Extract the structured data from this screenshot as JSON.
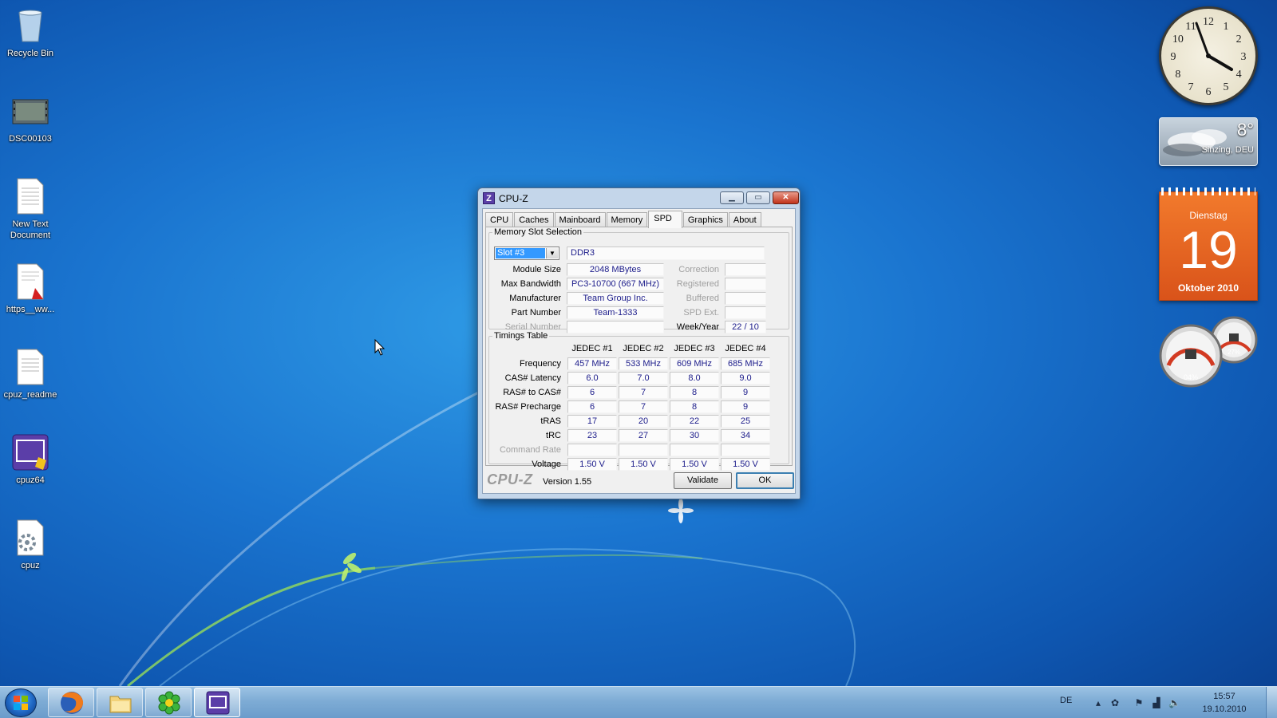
{
  "desktop": {
    "icons": [
      {
        "label": "Recycle Bin"
      },
      {
        "label": "DSC00103"
      },
      {
        "label": "New Text Document"
      },
      {
        "label": "https__ww..."
      },
      {
        "label": "cpuz_readme"
      },
      {
        "label": "cpuz64"
      },
      {
        "label": "cpuz"
      }
    ]
  },
  "window": {
    "title": "CPU-Z",
    "tabs": [
      "CPU",
      "Caches",
      "Mainboard",
      "Memory",
      "SPD",
      "Graphics",
      "About"
    ],
    "active_tab": "SPD",
    "slot_group": {
      "legend": "Memory Slot Selection",
      "slot_selected": "Slot #3",
      "memory_type": "DDR3",
      "labels": {
        "module_size": "Module Size",
        "max_bandwidth": "Max Bandwidth",
        "manufacturer": "Manufacturer",
        "part_number": "Part Number",
        "serial_number": "Serial Number",
        "correction": "Correction",
        "registered": "Registered",
        "buffered": "Buffered",
        "spd_ext": "SPD Ext.",
        "week_year": "Week/Year"
      },
      "values": {
        "module_size": "2048 MBytes",
        "max_bandwidth": "PC3-10700 (667 MHz)",
        "manufacturer": "Team Group Inc.",
        "part_number": "Team-1333",
        "serial_number": "",
        "correction": "",
        "registered": "",
        "buffered": "",
        "spd_ext": "",
        "week_year": "22 / 10"
      }
    },
    "timings": {
      "legend": "Timings Table",
      "columns": [
        "JEDEC #1",
        "JEDEC #2",
        "JEDEC #3",
        "JEDEC #4"
      ],
      "rows": [
        {
          "label": "Frequency",
          "values": [
            "457 MHz",
            "533 MHz",
            "609 MHz",
            "685 MHz"
          ]
        },
        {
          "label": "CAS# Latency",
          "values": [
            "6.0",
            "7.0",
            "8.0",
            "9.0"
          ]
        },
        {
          "label": "RAS# to CAS#",
          "values": [
            "6",
            "7",
            "8",
            "9"
          ]
        },
        {
          "label": "RAS# Precharge",
          "values": [
            "6",
            "7",
            "8",
            "9"
          ]
        },
        {
          "label": "tRAS",
          "values": [
            "17",
            "20",
            "22",
            "25"
          ]
        },
        {
          "label": "tRC",
          "values": [
            "23",
            "27",
            "30",
            "34"
          ]
        },
        {
          "label": "Command Rate",
          "values": [
            "",
            "",
            "",
            ""
          ]
        },
        {
          "label": "Voltage",
          "values": [
            "1.50 V",
            "1.50 V",
            "1.50 V",
            "1.50 V"
          ]
        }
      ]
    },
    "brand": "CPU-Z",
    "version": "Version 1.55",
    "validate_label": "Validate",
    "ok_label": "OK"
  },
  "gadgets": {
    "clock_numbers": [
      "12",
      "1",
      "2",
      "3",
      "4",
      "5",
      "6",
      "7",
      "8",
      "9",
      "10",
      "11"
    ],
    "weather": {
      "temp": "8°",
      "city": "Sinzing, DEU"
    },
    "calendar": {
      "weekday": "Dienstag",
      "day": "19",
      "month": "Oktober 2010"
    },
    "meter": {
      "cpu": "04%",
      "ram": "27%"
    }
  },
  "taskbar": {
    "language": "DE",
    "time": "15:57",
    "date": "19.10.2010"
  }
}
